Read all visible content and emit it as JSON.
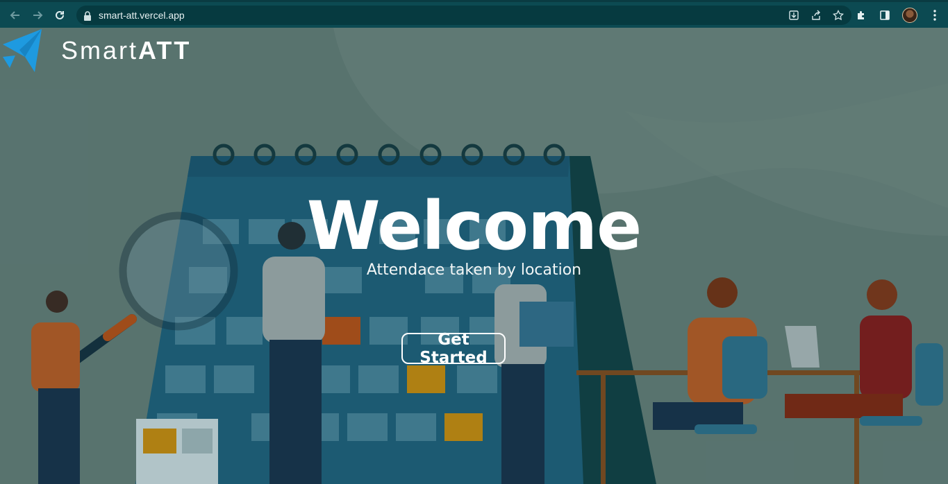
{
  "browser": {
    "url": "smart-att.vercel.app",
    "icons": {
      "back": "arrow-left-icon",
      "forward": "arrow-right-icon",
      "reload": "reload-icon",
      "lock": "lock-icon",
      "install": "install-icon",
      "share": "share-icon",
      "bookmark": "star-icon",
      "extensions": "puzzle-icon",
      "sidepanel": "side-panel-icon",
      "profile": "avatar",
      "menu": "kebab-menu-icon"
    }
  },
  "site": {
    "brand_light": "Smart",
    "brand_bold": "ATT",
    "logo_icon": "paper-plane-icon",
    "hero_title": "Welcome",
    "hero_subtitle": "Attendace taken by location",
    "cta_label": "Get Started"
  },
  "colors": {
    "chrome_bg": "#0c4a52",
    "logo_blue": "#1e9ae0",
    "page_overlay": "#607b75",
    "text": "#ffffff"
  }
}
